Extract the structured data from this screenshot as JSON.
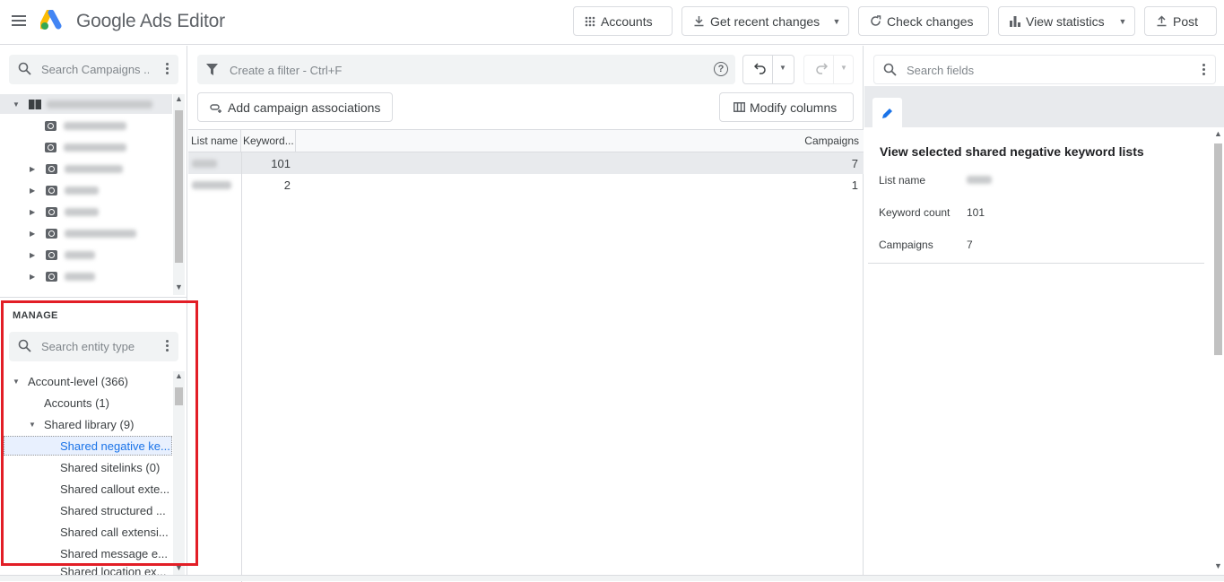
{
  "app": {
    "title": "Google Ads Editor"
  },
  "toolbar": {
    "accounts": "Accounts",
    "get_recent_changes": "Get recent changes",
    "check_changes": "Check changes",
    "view_statistics": "View statistics",
    "post": "Post"
  },
  "left": {
    "campaign_search_placeholder": "Search Campaigns ...",
    "manage_title": "MANAGE",
    "entity_search_placeholder": "Search entity type",
    "tree": [
      {
        "label": "Account-level (366)"
      },
      {
        "label": "Accounts (1)"
      },
      {
        "label": "Shared library (9)"
      },
      {
        "label": "Shared negative ke..."
      },
      {
        "label": "Shared sitelinks (0)"
      },
      {
        "label": "Shared callout exte..."
      },
      {
        "label": "Shared structured ..."
      },
      {
        "label": "Shared call extensi..."
      },
      {
        "label": "Shared message e..."
      },
      {
        "label": "Shared location ex..."
      }
    ]
  },
  "center": {
    "filter_placeholder": "Create a filter - Ctrl+F",
    "add_campaign_associations": "Add campaign associations",
    "modify_columns": "Modify columns",
    "columns": [
      "List name",
      "Keyword...",
      "Campaigns"
    ],
    "rows": [
      {
        "keyword_count": "101",
        "campaigns": "7"
      },
      {
        "keyword_count": "2",
        "campaigns": "1"
      }
    ]
  },
  "right": {
    "search_fields_placeholder": "Search fields",
    "title": "View selected shared negative keyword lists",
    "fields": [
      {
        "label": "List name",
        "value": ""
      },
      {
        "label": "Keyword count",
        "value": "101"
      },
      {
        "label": "Campaigns",
        "value": "7"
      }
    ]
  },
  "colors": {
    "accent": "#1a73e8",
    "highlight_box": "#e21e26"
  }
}
